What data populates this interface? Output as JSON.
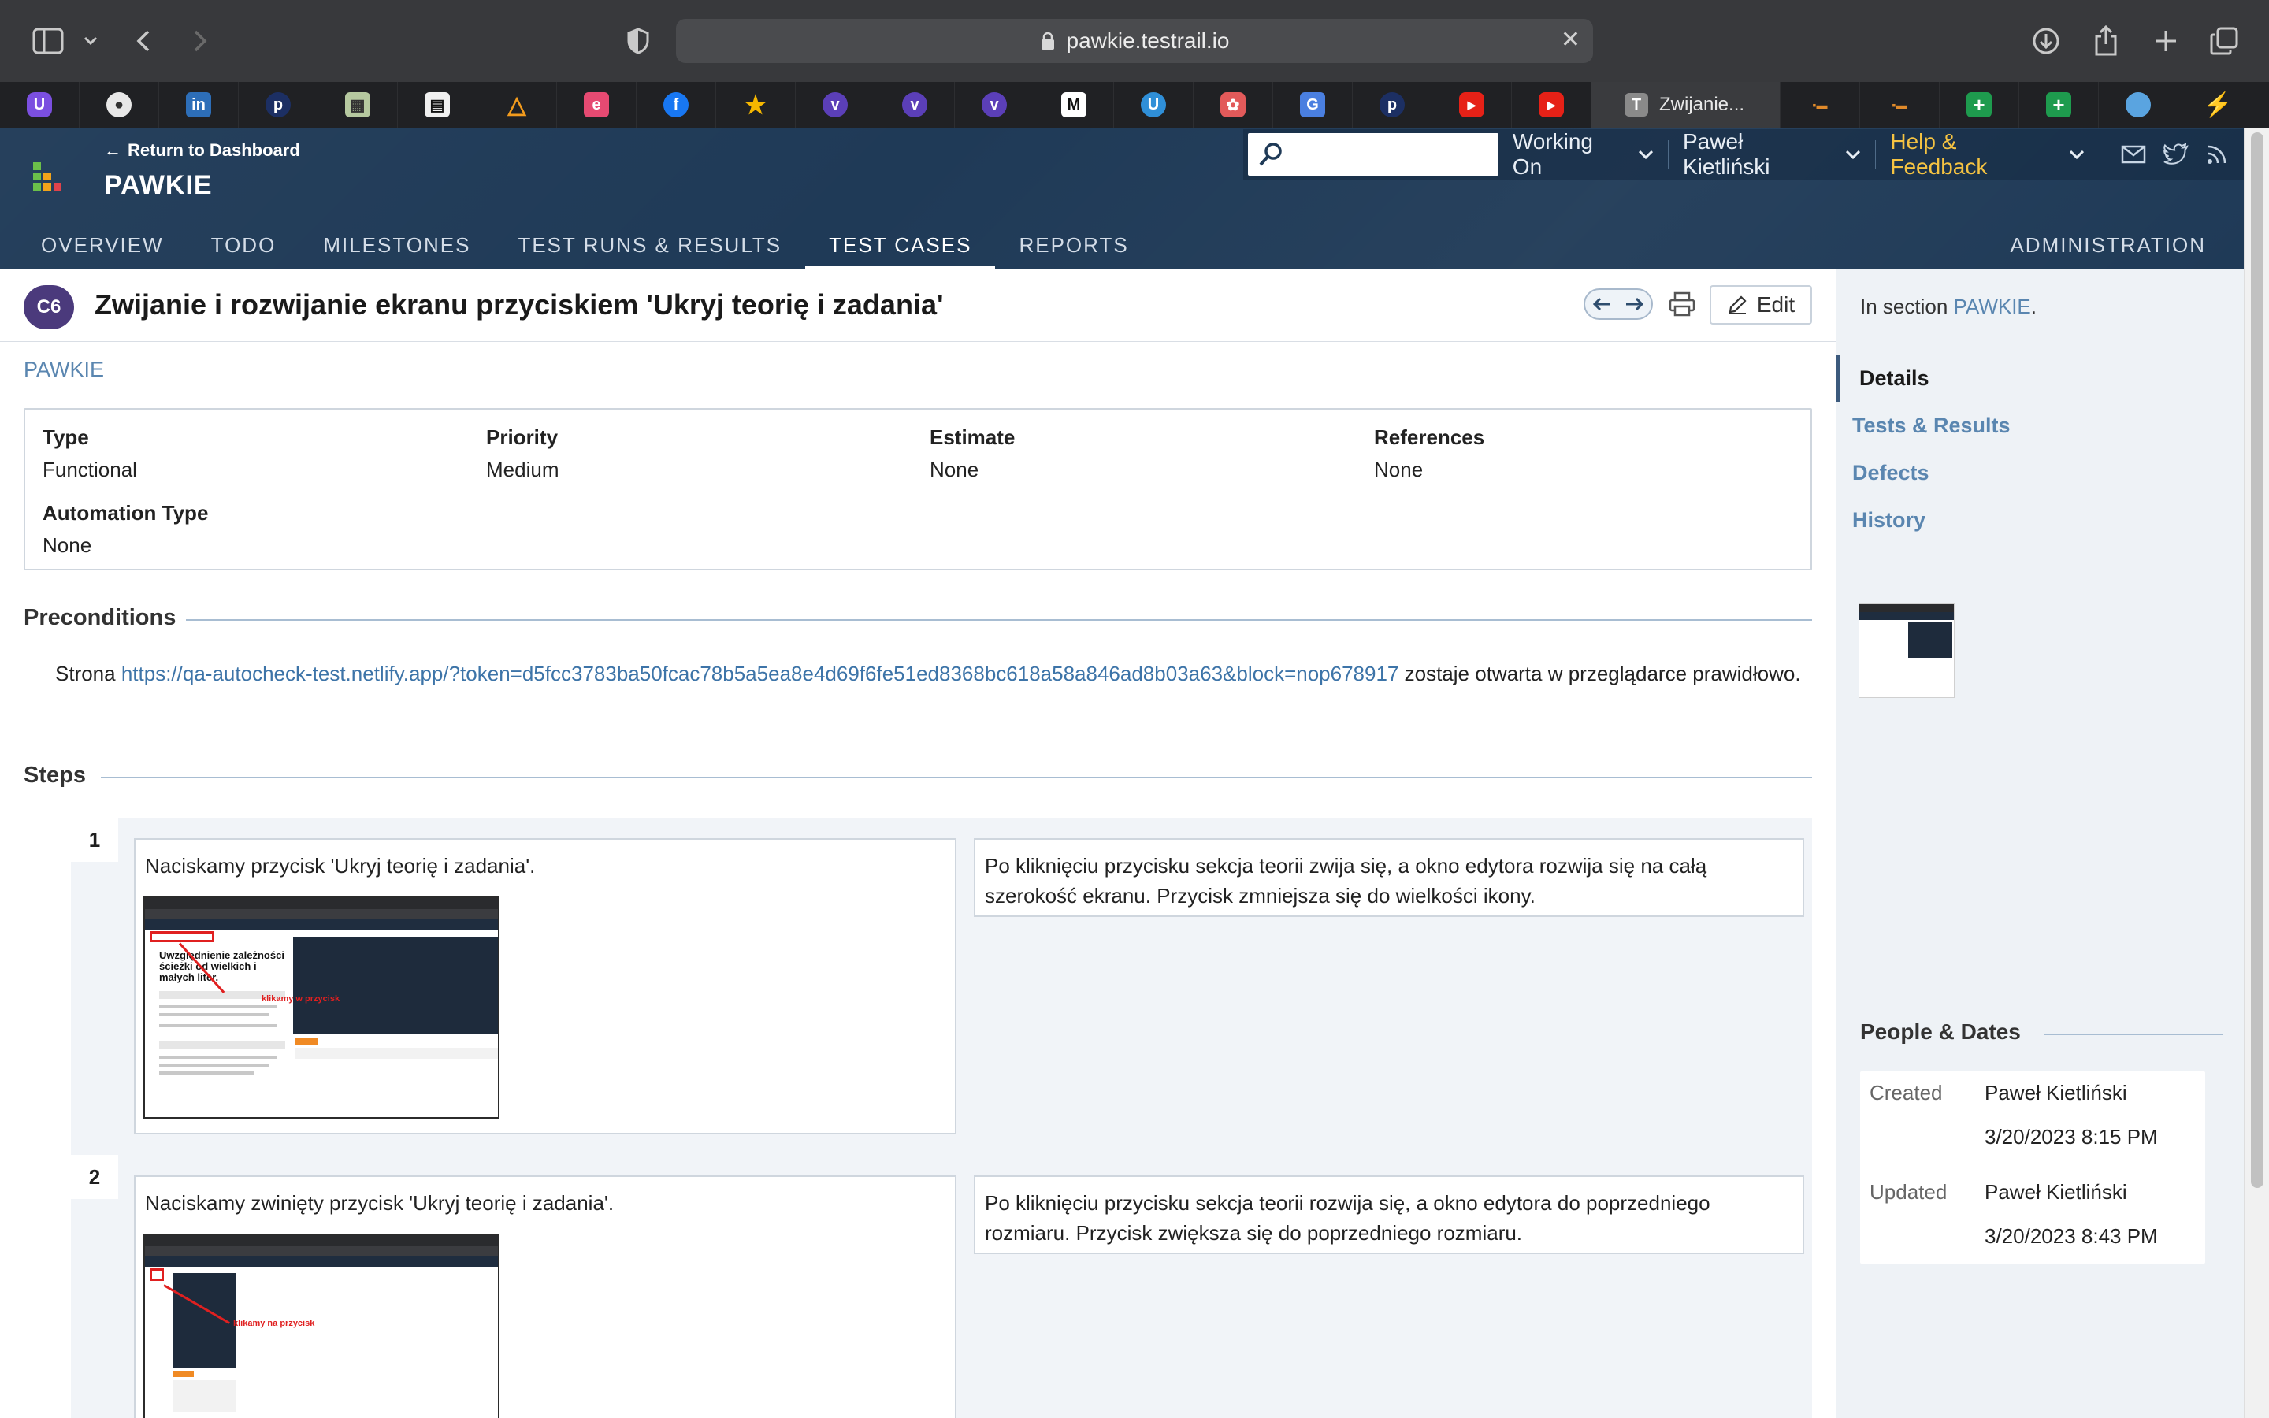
{
  "browser": {
    "url": "pawkie.testrail.io",
    "active_tab_title": "Zwijanie...",
    "favicons": [
      "u-icon",
      "bird-icon",
      "linkedin-icon",
      "p-icon",
      "image-icon",
      "book-icon",
      "triangle-icon",
      "e-icon",
      "facebook-icon",
      "star-icon",
      "v-icon",
      "v-icon",
      "v-icon",
      "m-icon",
      "u-icon",
      "openai-icon",
      "translate-icon",
      "p-icon",
      "youtube-icon",
      "youtube-icon"
    ],
    "after_tab_favicons": [
      "flag-icon",
      "flag-icon",
      "plus-sheet-icon",
      "plus-sheet-icon",
      "drop-icon",
      "bolt-icon"
    ]
  },
  "header": {
    "return_label": "Return to Dashboard",
    "project": "PAWKIE",
    "working_on": "Working On",
    "user": "Paweł Kietliński",
    "help": "Help & Feedback",
    "nav": [
      "OVERVIEW",
      "TODO",
      "MILESTONES",
      "TEST RUNS & RESULTS",
      "TEST CASES",
      "REPORTS"
    ],
    "active_nav": "TEST CASES",
    "admin": "ADMINISTRATION"
  },
  "case": {
    "id": "C6",
    "title": "Zwijanie i rozwijanie ekranu przyciskiem 'Ukryj teorię i zadania'",
    "edit": "Edit",
    "breadcrumb": "PAWKIE",
    "fields": {
      "type_label": "Type",
      "type_value": "Functional",
      "priority_label": "Priority",
      "priority_value": "Medium",
      "estimate_label": "Estimate",
      "estimate_value": "None",
      "references_label": "References",
      "references_value": "None",
      "automation_label": "Automation Type",
      "automation_value": "None"
    },
    "preconditions_title": "Preconditions",
    "precondition_prefix": "Strona",
    "precondition_link": "https://qa-autocheck-test.netlify.app/?token=d5fcc3783ba50fcac78b5a5ea8e4d69f6fe51ed8368bc618a58a846ad8b03a63&block=nop678917",
    "precondition_suffix": "zostaje otwarta w przeglądarce prawidłowo.",
    "steps_title": "Steps",
    "steps": [
      {
        "num": "1",
        "action": "Naciskamy przycisk 'Ukryj teorię i zadania'.",
        "expected": "Po kliknięciu przycisku sekcja teorii zwija się, a okno edytora rozwija się na całą szerokość ekranu. Przycisk zmniejsza się do wielkości ikony.",
        "shot_heading": "Uwzględnienie zależności ścieżki od wielkich i małych liter.",
        "shot_note": "klikamy w przycisk"
      },
      {
        "num": "2",
        "action": "Naciskamy zwinięty przycisk 'Ukryj teorię i zadania'.",
        "expected": "Po kliknięciu przycisku sekcja teorii rozwija się, a okno edytora do poprzedniego rozmiaru. Przycisk zwiększa się do poprzedniego rozmiaru.",
        "shot_note": "klikamy na przycisk"
      }
    ]
  },
  "sidebar": {
    "in_section_prefix": "In section",
    "in_section_link": "PAWKIE",
    "menu": [
      "Details",
      "Tests & Results",
      "Defects",
      "History"
    ],
    "active": "Details",
    "people_title": "People & Dates",
    "created_label": "Created",
    "created_by": "Paweł Kietliński",
    "created_at": "3/20/2023 8:15 PM",
    "updated_label": "Updated",
    "updated_by": "Paweł Kietliński",
    "updated_at": "3/20/2023 8:43 PM"
  },
  "colors": {
    "header_bg": "#1f3a57",
    "link": "#5a86b0",
    "help": "#f5c342",
    "case_badge": "#4b3a7c"
  }
}
